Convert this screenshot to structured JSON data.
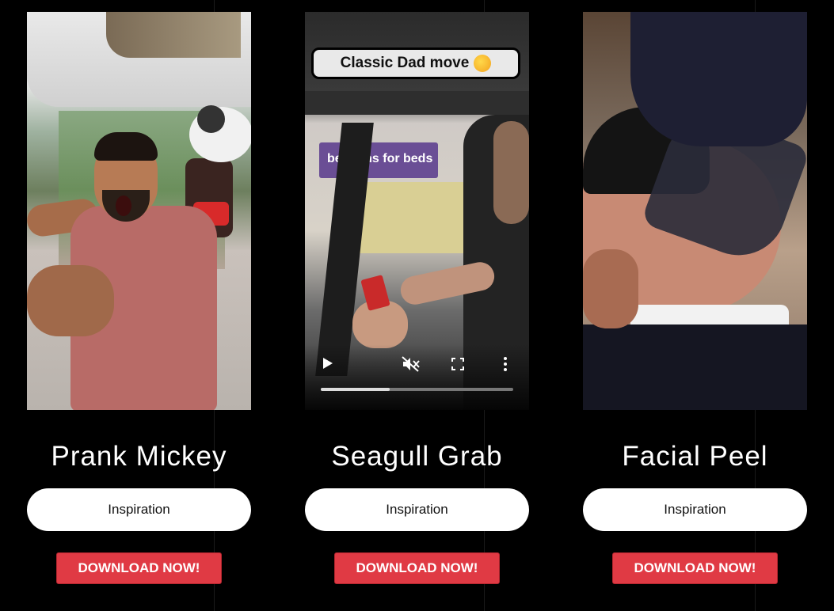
{
  "cards": [
    {
      "title": "Prank Mickey",
      "button_label": "Inspiration",
      "download_label": "DOWNLOAD NOW!"
    },
    {
      "title": "Seagull Grab",
      "button_label": "Inspiration",
      "download_label": "DOWNLOAD NOW!",
      "overlay_text": "Classic Dad move",
      "sign_text": "bensons for beds",
      "video_progress": 0.36
    },
    {
      "title": "Facial Peel",
      "button_label": "Inspiration",
      "download_label": "DOWNLOAD NOW!"
    }
  ],
  "colors": {
    "background": "#000000",
    "download_button": "#e03a44",
    "pill_button": "#ffffff"
  },
  "video_controls": {
    "play_icon": "play-icon",
    "mute_icon": "muted-icon",
    "fullscreen_icon": "fullscreen-icon",
    "menu_icon": "more-vertical-icon"
  }
}
